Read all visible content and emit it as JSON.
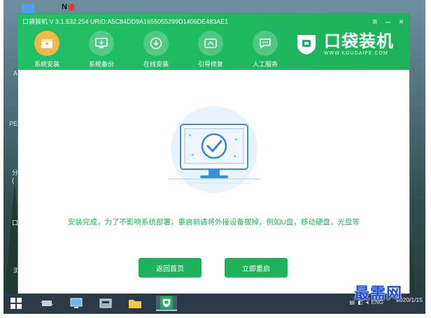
{
  "app": {
    "title": "口袋装机 V 3.1.532.254 URID:A5C84DD9A1655055299D1406DE483AE1",
    "brand_name": "口袋装机",
    "brand_url": "WWW.KOUDAIPE.COM",
    "accent_color": "#1cb35b",
    "active_color": "#f5b74a"
  },
  "window_controls": {
    "menu": "≡",
    "minimize": "–",
    "close": "×"
  },
  "nav": [
    {
      "label": "系统安装",
      "icon": "install-box-icon",
      "active": true
    },
    {
      "label": "系统备份",
      "icon": "backup-icon",
      "active": false
    },
    {
      "label": "在线安装",
      "icon": "download-icon",
      "active": false
    },
    {
      "label": "引导修复",
      "icon": "repair-icon",
      "active": false
    },
    {
      "label": "人工服务",
      "icon": "chat-icon",
      "active": false
    }
  ],
  "main": {
    "message": "安装完成，为了不影响系统部署，重启前请将外接设备拔掉，例如U盘，移动硬盘，光盘等",
    "buttons": {
      "home": "返回首页",
      "reboot": "立即重启"
    }
  },
  "desktop": {
    "badge": "N",
    "fragments": [
      "A",
      "PE",
      "分",
      "(",
      "口",
      "浏"
    ]
  },
  "taskbar": {
    "tray_text": "ENG",
    "time": "",
    "date": "2020/1/15"
  },
  "watermark": "最需网"
}
